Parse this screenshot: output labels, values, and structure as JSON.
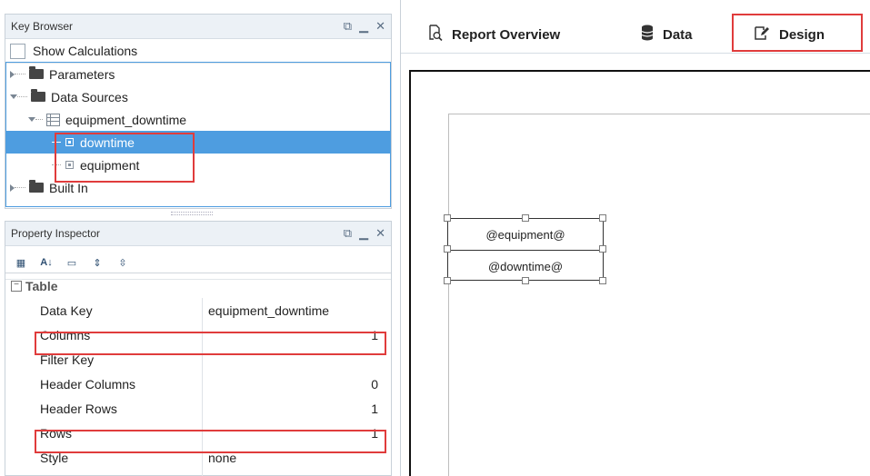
{
  "key_browser": {
    "title": "Key Browser",
    "show_calculations": "Show Calculations",
    "tree": {
      "parameters": "Parameters",
      "data_sources": "Data Sources",
      "equipment_downtime": "equipment_downtime",
      "downtime": "downtime",
      "equipment": "equipment",
      "built_in": "Built In"
    }
  },
  "property_inspector": {
    "title": "Property Inspector",
    "section": "Table",
    "rows": [
      {
        "key": "Data Key",
        "value": "equipment_downtime"
      },
      {
        "key": "Columns",
        "value": "1"
      },
      {
        "key": "Filter Key",
        "value": ""
      },
      {
        "key": "Header Columns",
        "value": "0"
      },
      {
        "key": "Header Rows",
        "value": "1"
      },
      {
        "key": "Rows",
        "value": "1"
      },
      {
        "key": "Style",
        "value": "none"
      }
    ]
  },
  "tabs": {
    "report_overview": "Report Overview",
    "data": "Data",
    "design": "Design"
  },
  "design_canvas": {
    "row1": "@equipment@",
    "row2": "@downtime@"
  },
  "colors": {
    "highlight_red": "#e03c3c",
    "selection_blue": "#4e9de0"
  }
}
